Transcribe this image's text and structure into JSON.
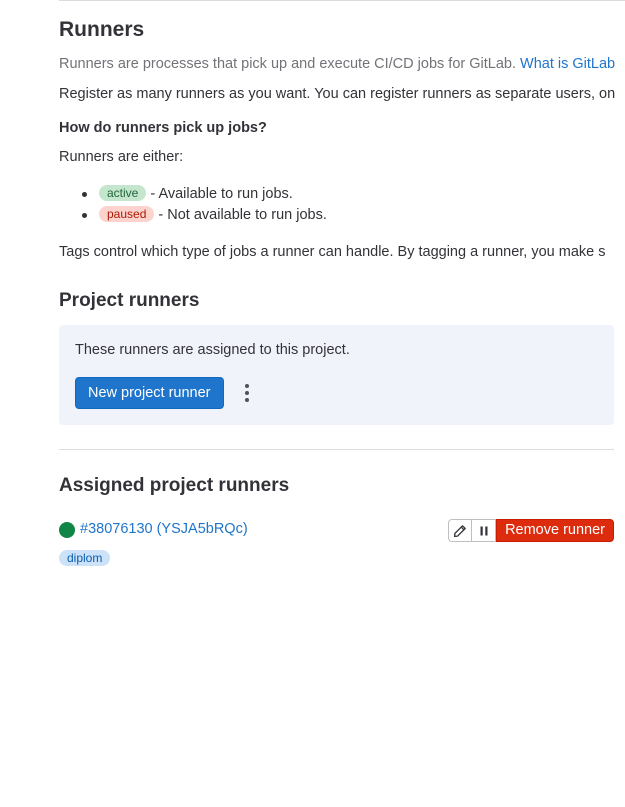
{
  "runners_section": {
    "title": "Runners",
    "intro_text": "Runners are processes that pick up and execute CI/CD jobs for GitLab.",
    "intro_link": "What is GitLab",
    "register_text": "Register as many runners as you want. You can register runners as separate users, on",
    "question_heading": "How do runners pick up jobs?",
    "either_text": "Runners are either:",
    "statuses": [
      {
        "badge": "active",
        "description": "- Available to run jobs."
      },
      {
        "badge": "paused",
        "description": "- Not available to run jobs."
      }
    ],
    "tags_text": "Tags control which type of jobs a runner can handle. By tagging a runner, you make s"
  },
  "project_runners": {
    "title": "Project runners",
    "panel_text": "These runners are assigned to this project.",
    "new_runner_button": "New project runner",
    "more_actions_icon": "ellipsis-v-icon"
  },
  "assigned_runners": {
    "title": "Assigned project runners",
    "runners": [
      {
        "status_icon": "status-online-icon",
        "label": "#38076130 (YSJA5bRQc)",
        "tags": [
          "diplom"
        ],
        "edit_icon": "pencil-icon",
        "pause_icon": "pause-icon",
        "remove_button": "Remove runner"
      }
    ]
  },
  "colors": {
    "link": "#1f75cb",
    "primary_button": "#1f75cb",
    "danger_button": "#dd2b0e",
    "online_status": "#108548",
    "panel_background": "#f0f4fa"
  }
}
